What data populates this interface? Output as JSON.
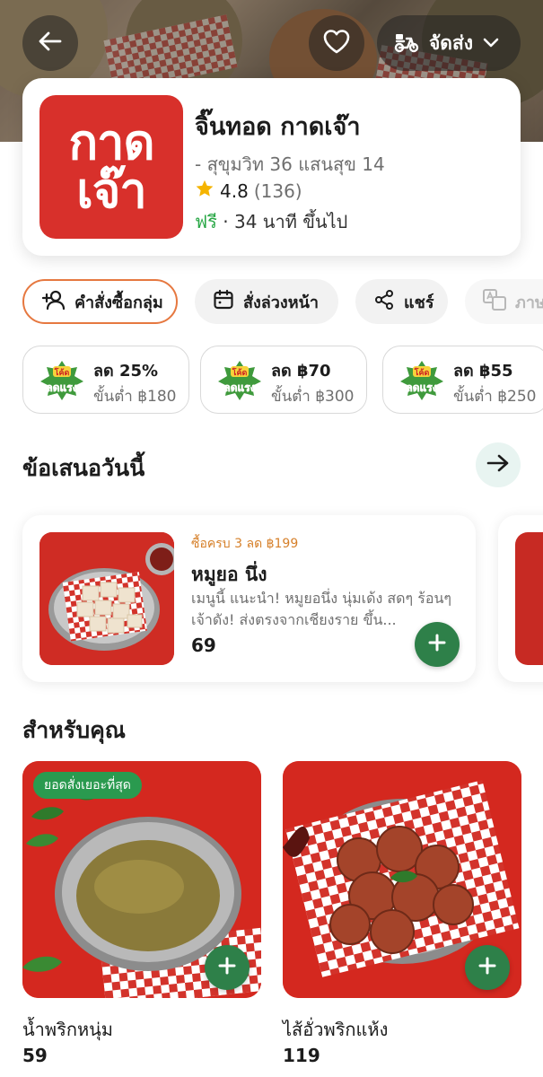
{
  "header": {
    "delivery_label": "จัดส่ง"
  },
  "store": {
    "logo_line1": "กาด",
    "logo_line2": "เจ๊า",
    "name": "จิ๊นทอด กาดเจ๊า",
    "branch": "- สุขุมวิท 36 แสนสุข 14",
    "rating": "4.8",
    "rating_count": "(136)",
    "delivery_free": "ฟรี",
    "delivery_sep": " · ",
    "delivery_time": "34 นาที ขึ้นไป"
  },
  "actions": {
    "group_order": "คำสั่งซื้อกลุ่ม",
    "schedule": "สั่งล่วงหน้า",
    "share": "แชร์",
    "translate": "ภาษ"
  },
  "promos": [
    {
      "badge_top": "โค้ด",
      "badge_bottom": "ลดแรง",
      "discount": "ลด 25%",
      "min_order": "ขั้นต่ำ ฿180"
    },
    {
      "badge_top": "โค้ด",
      "badge_bottom": "ลดแรง",
      "discount": "ลด ฿70",
      "min_order": "ขั้นต่ำ ฿300"
    },
    {
      "badge_top": "โค้ด",
      "badge_bottom": "ลดแรง",
      "discount": "ลด ฿55",
      "min_order": "ขั้นต่ำ ฿250"
    }
  ],
  "offers_section": {
    "title": "ข้อเสนอวันนี้",
    "item": {
      "promo": "ซื้อครบ 3 ลด ฿199",
      "name": "หมูยอ นึ่ง",
      "description": "เมนูนี้ แนะนำ! หมูยอนึ่ง นุ่มเด้ง สดๆ ร้อนๆ เจ้าดัง! ส่งตรงจากเชียงราย ขึ้น...",
      "price": "69"
    }
  },
  "for_you": {
    "title": "สำหรับคุณ",
    "items": [
      {
        "badge": "ยอดสั่งเยอะที่สุด",
        "name": "น้ำพริกหนุ่ม",
        "price": "59"
      },
      {
        "name": "ไส้อั่วพริกแห้ง",
        "price": "119"
      }
    ]
  },
  "colors": {
    "brand_red": "#d8302b",
    "action_green": "#2e8049",
    "badge_green": "#2a9a4f",
    "free_green": "#28a745",
    "promo_orange": "#d6802a",
    "group_border": "#e67840"
  },
  "icons": [
    "back-arrow-icon",
    "heart-icon",
    "scooter-icon",
    "chevron-down-icon",
    "star-icon",
    "group-add-icon",
    "calendar-icon",
    "share-icon",
    "translate-icon",
    "arrow-right-icon",
    "plus-icon"
  ]
}
